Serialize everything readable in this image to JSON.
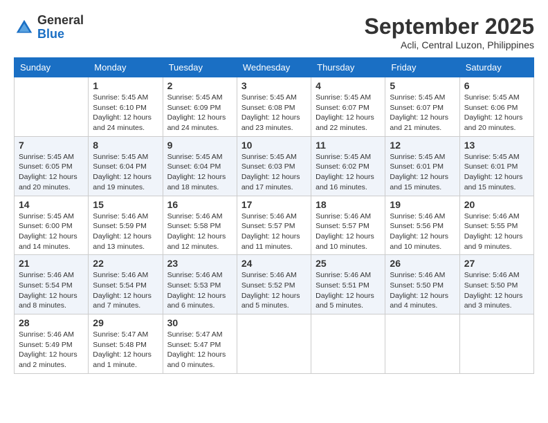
{
  "header": {
    "logo_general": "General",
    "logo_blue": "Blue",
    "month": "September 2025",
    "location": "Acli, Central Luzon, Philippines"
  },
  "days_of_week": [
    "Sunday",
    "Monday",
    "Tuesday",
    "Wednesday",
    "Thursday",
    "Friday",
    "Saturday"
  ],
  "weeks": [
    [
      {
        "day": "",
        "info": ""
      },
      {
        "day": "1",
        "info": "Sunrise: 5:45 AM\nSunset: 6:10 PM\nDaylight: 12 hours\nand 24 minutes."
      },
      {
        "day": "2",
        "info": "Sunrise: 5:45 AM\nSunset: 6:09 PM\nDaylight: 12 hours\nand 24 minutes."
      },
      {
        "day": "3",
        "info": "Sunrise: 5:45 AM\nSunset: 6:08 PM\nDaylight: 12 hours\nand 23 minutes."
      },
      {
        "day": "4",
        "info": "Sunrise: 5:45 AM\nSunset: 6:07 PM\nDaylight: 12 hours\nand 22 minutes."
      },
      {
        "day": "5",
        "info": "Sunrise: 5:45 AM\nSunset: 6:07 PM\nDaylight: 12 hours\nand 21 minutes."
      },
      {
        "day": "6",
        "info": "Sunrise: 5:45 AM\nSunset: 6:06 PM\nDaylight: 12 hours\nand 20 minutes."
      }
    ],
    [
      {
        "day": "7",
        "info": "Sunrise: 5:45 AM\nSunset: 6:05 PM\nDaylight: 12 hours\nand 20 minutes."
      },
      {
        "day": "8",
        "info": "Sunrise: 5:45 AM\nSunset: 6:04 PM\nDaylight: 12 hours\nand 19 minutes."
      },
      {
        "day": "9",
        "info": "Sunrise: 5:45 AM\nSunset: 6:04 PM\nDaylight: 12 hours\nand 18 minutes."
      },
      {
        "day": "10",
        "info": "Sunrise: 5:45 AM\nSunset: 6:03 PM\nDaylight: 12 hours\nand 17 minutes."
      },
      {
        "day": "11",
        "info": "Sunrise: 5:45 AM\nSunset: 6:02 PM\nDaylight: 12 hours\nand 16 minutes."
      },
      {
        "day": "12",
        "info": "Sunrise: 5:45 AM\nSunset: 6:01 PM\nDaylight: 12 hours\nand 15 minutes."
      },
      {
        "day": "13",
        "info": "Sunrise: 5:45 AM\nSunset: 6:01 PM\nDaylight: 12 hours\nand 15 minutes."
      }
    ],
    [
      {
        "day": "14",
        "info": "Sunrise: 5:45 AM\nSunset: 6:00 PM\nDaylight: 12 hours\nand 14 minutes."
      },
      {
        "day": "15",
        "info": "Sunrise: 5:46 AM\nSunset: 5:59 PM\nDaylight: 12 hours\nand 13 minutes."
      },
      {
        "day": "16",
        "info": "Sunrise: 5:46 AM\nSunset: 5:58 PM\nDaylight: 12 hours\nand 12 minutes."
      },
      {
        "day": "17",
        "info": "Sunrise: 5:46 AM\nSunset: 5:57 PM\nDaylight: 12 hours\nand 11 minutes."
      },
      {
        "day": "18",
        "info": "Sunrise: 5:46 AM\nSunset: 5:57 PM\nDaylight: 12 hours\nand 10 minutes."
      },
      {
        "day": "19",
        "info": "Sunrise: 5:46 AM\nSunset: 5:56 PM\nDaylight: 12 hours\nand 10 minutes."
      },
      {
        "day": "20",
        "info": "Sunrise: 5:46 AM\nSunset: 5:55 PM\nDaylight: 12 hours\nand 9 minutes."
      }
    ],
    [
      {
        "day": "21",
        "info": "Sunrise: 5:46 AM\nSunset: 5:54 PM\nDaylight: 12 hours\nand 8 minutes."
      },
      {
        "day": "22",
        "info": "Sunrise: 5:46 AM\nSunset: 5:54 PM\nDaylight: 12 hours\nand 7 minutes."
      },
      {
        "day": "23",
        "info": "Sunrise: 5:46 AM\nSunset: 5:53 PM\nDaylight: 12 hours\nand 6 minutes."
      },
      {
        "day": "24",
        "info": "Sunrise: 5:46 AM\nSunset: 5:52 PM\nDaylight: 12 hours\nand 5 minutes."
      },
      {
        "day": "25",
        "info": "Sunrise: 5:46 AM\nSunset: 5:51 PM\nDaylight: 12 hours\nand 5 minutes."
      },
      {
        "day": "26",
        "info": "Sunrise: 5:46 AM\nSunset: 5:50 PM\nDaylight: 12 hours\nand 4 minutes."
      },
      {
        "day": "27",
        "info": "Sunrise: 5:46 AM\nSunset: 5:50 PM\nDaylight: 12 hours\nand 3 minutes."
      }
    ],
    [
      {
        "day": "28",
        "info": "Sunrise: 5:46 AM\nSunset: 5:49 PM\nDaylight: 12 hours\nand 2 minutes."
      },
      {
        "day": "29",
        "info": "Sunrise: 5:47 AM\nSunset: 5:48 PM\nDaylight: 12 hours\nand 1 minute."
      },
      {
        "day": "30",
        "info": "Sunrise: 5:47 AM\nSunset: 5:47 PM\nDaylight: 12 hours\nand 0 minutes."
      },
      {
        "day": "",
        "info": ""
      },
      {
        "day": "",
        "info": ""
      },
      {
        "day": "",
        "info": ""
      },
      {
        "day": "",
        "info": ""
      }
    ]
  ]
}
